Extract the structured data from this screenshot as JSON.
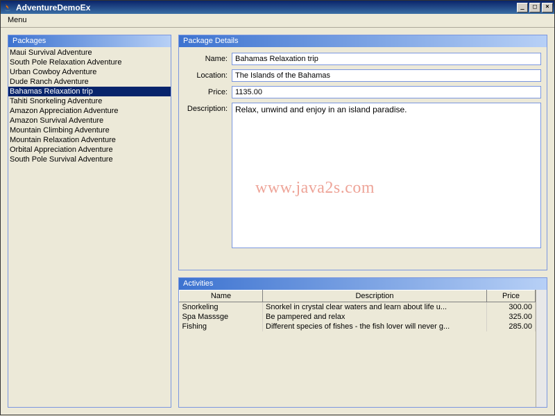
{
  "window": {
    "title": "AdventureDemoEx",
    "icon": "java-icon",
    "buttons": {
      "min": "_",
      "max": "□",
      "close": "×"
    }
  },
  "menubar": {
    "items": [
      "Menu"
    ]
  },
  "packages_panel": {
    "title": "Packages",
    "selected_index": 4,
    "items": [
      "Maui Survival Adventure",
      "South Pole Relaxation Adventure",
      "Urban Cowboy Adventure",
      "Dude Ranch Adventure",
      "Bahamas Relaxation trip",
      "Tahiti Snorkeling Adventure",
      "Amazon Appreciation Adventure",
      "Amazon Survival Adventure",
      "Mountain Climbing Adventure",
      "Mountain Relaxation Adventure",
      "Orbital Appreciation Adventure",
      "South Pole Survival Adventure"
    ]
  },
  "details_panel": {
    "title": "Package Details",
    "labels": {
      "name": "Name:",
      "location": "Location:",
      "price": "Price:",
      "description": "Description:"
    },
    "fields": {
      "name": "Bahamas Relaxation trip",
      "location": "The Islands of the Bahamas",
      "price": "1135.00",
      "description": "Relax, unwind and enjoy in an island paradise."
    }
  },
  "activities_panel": {
    "title": "Activities",
    "columns": {
      "name": "Name",
      "description": "Description",
      "price": "Price"
    },
    "rows": [
      {
        "name": "Snorkeling",
        "description": "Snorkel in crystal clear waters and learn  about life u...",
        "price": "300.00"
      },
      {
        "name": "Spa Masssge",
        "description": "Be pampered and relax",
        "price": "325.00"
      },
      {
        "name": "Fishing",
        "description": "Different species of fishes - the fish lover will never g...",
        "price": "285.00"
      }
    ]
  },
  "watermark": "www.java2s.com"
}
